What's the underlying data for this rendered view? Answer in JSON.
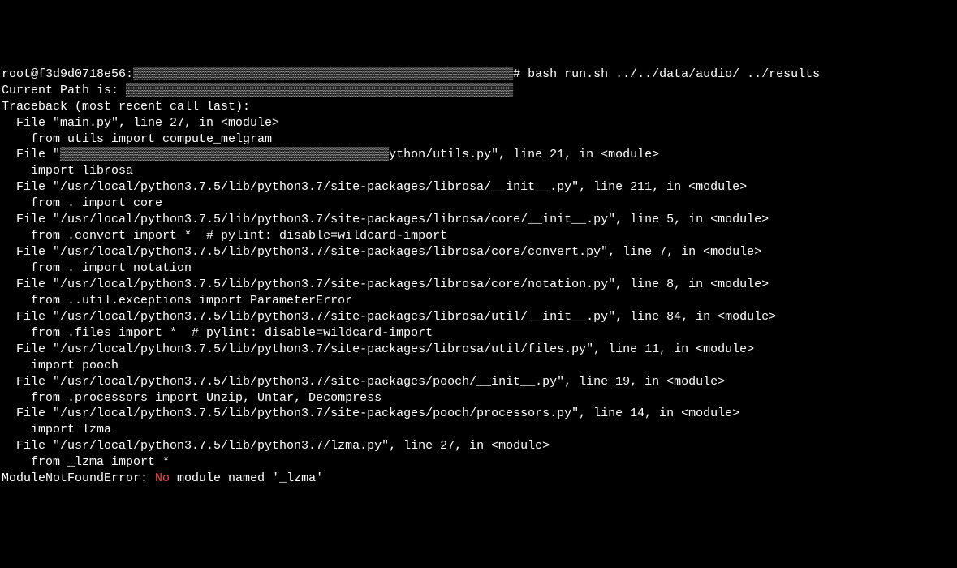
{
  "lines": [
    {
      "text": "root@f3d9d0718e56:▒▒▒▒▒▒▒▒▒▒▒▒▒▒▒▒▒▒▒▒▒▒▒▒▒▒▒▒▒▒▒▒▒▒▒▒▒▒▒▒▒▒▒▒▒▒▒▒▒▒▒▒# bash run.sh ../../data/audio/ ../results"
    },
    {
      "text": "Current Path is: ▒▒▒▒▒▒▒▒▒▒▒▒▒▒▒▒▒▒▒▒▒▒▒▒▒▒▒▒▒▒▒▒▒▒▒▒▒▒▒▒▒▒▒▒▒▒▒▒▒▒▒▒▒"
    },
    {
      "text": "Traceback (most recent call last):"
    },
    {
      "text": "  File \"main.py\", line 27, in <module>"
    },
    {
      "text": "    from utils import compute_melgram"
    },
    {
      "text": "  File \"▒▒▒▒▒▒▒▒▒▒▒▒▒▒▒▒▒▒▒▒▒▒▒▒▒▒▒▒▒▒▒▒▒▒▒▒▒▒▒▒▒▒▒▒▒ython/utils.py\", line 21, in <module>"
    },
    {
      "text": "    import librosa"
    },
    {
      "text": "  File \"/usr/local/python3.7.5/lib/python3.7/site-packages/librosa/__init__.py\", line 211, in <module>"
    },
    {
      "text": "    from . import core"
    },
    {
      "text": "  File \"/usr/local/python3.7.5/lib/python3.7/site-packages/librosa/core/__init__.py\", line 5, in <module>"
    },
    {
      "text": "    from .convert import *  # pylint: disable=wildcard-import"
    },
    {
      "text": "  File \"/usr/local/python3.7.5/lib/python3.7/site-packages/librosa/core/convert.py\", line 7, in <module>"
    },
    {
      "text": "    from . import notation"
    },
    {
      "text": "  File \"/usr/local/python3.7.5/lib/python3.7/site-packages/librosa/core/notation.py\", line 8, in <module>"
    },
    {
      "text": "    from ..util.exceptions import ParameterError"
    },
    {
      "text": "  File \"/usr/local/python3.7.5/lib/python3.7/site-packages/librosa/util/__init__.py\", line 84, in <module>"
    },
    {
      "text": "    from .files import *  # pylint: disable=wildcard-import"
    },
    {
      "text": "  File \"/usr/local/python3.7.5/lib/python3.7/site-packages/librosa/util/files.py\", line 11, in <module>"
    },
    {
      "text": "    import pooch"
    },
    {
      "text": "  File \"/usr/local/python3.7.5/lib/python3.7/site-packages/pooch/__init__.py\", line 19, in <module>"
    },
    {
      "text": "    from .processors import Unzip, Untar, Decompress"
    },
    {
      "text": "  File \"/usr/local/python3.7.5/lib/python3.7/site-packages/pooch/processors.py\", line 14, in <module>"
    },
    {
      "text": "    import lzma"
    },
    {
      "text": "  File \"/usr/local/python3.7.5/lib/python3.7/lzma.py\", line 27, in <module>"
    },
    {
      "text": "    from _lzma import *"
    }
  ],
  "error_prefix": "ModuleNotFoundError: ",
  "error_word": "No",
  "error_suffix": " module named '_lzma'"
}
